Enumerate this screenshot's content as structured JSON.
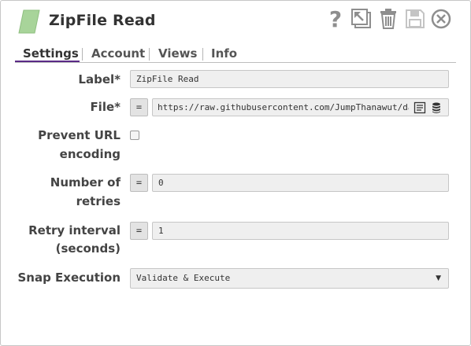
{
  "header": {
    "title": "ZipFile Read",
    "icons": [
      "snap-logo-icon",
      "help-icon",
      "expand-icon",
      "trash-icon",
      "save-icon",
      "close-icon"
    ],
    "help_glyph": "?"
  },
  "tabs": [
    {
      "label": "Settings",
      "active": true
    },
    {
      "label": "Account",
      "active": false
    },
    {
      "label": "Views",
      "active": false
    },
    {
      "label": "Info",
      "active": false
    }
  ],
  "form": {
    "label": {
      "caption": "Label*",
      "value": "ZipFile Read"
    },
    "file": {
      "caption": "File*",
      "expr_toggle": "=",
      "value": "https://raw.githubusercontent.com/JumpThanawut/da"
    },
    "prevent_url_encoding": {
      "caption_line1": "Prevent URL",
      "caption_line2": "encoding",
      "checked": false
    },
    "number_of_retries": {
      "caption_line1": "Number of",
      "caption_line2": "retries",
      "expr_toggle": "=",
      "value": "0"
    },
    "retry_interval": {
      "caption_line1": "Retry interval",
      "caption_line2": "(seconds)",
      "expr_toggle": "=",
      "value": "1"
    },
    "snap_execution": {
      "caption": "Snap Execution",
      "value": "Validate & Execute",
      "arrow": "▼"
    }
  },
  "colors": {
    "accent": "#5a2a86",
    "logo_green": "#a8d49a",
    "field_bg": "#efefef",
    "icon_gray": "#8e8e8e"
  }
}
